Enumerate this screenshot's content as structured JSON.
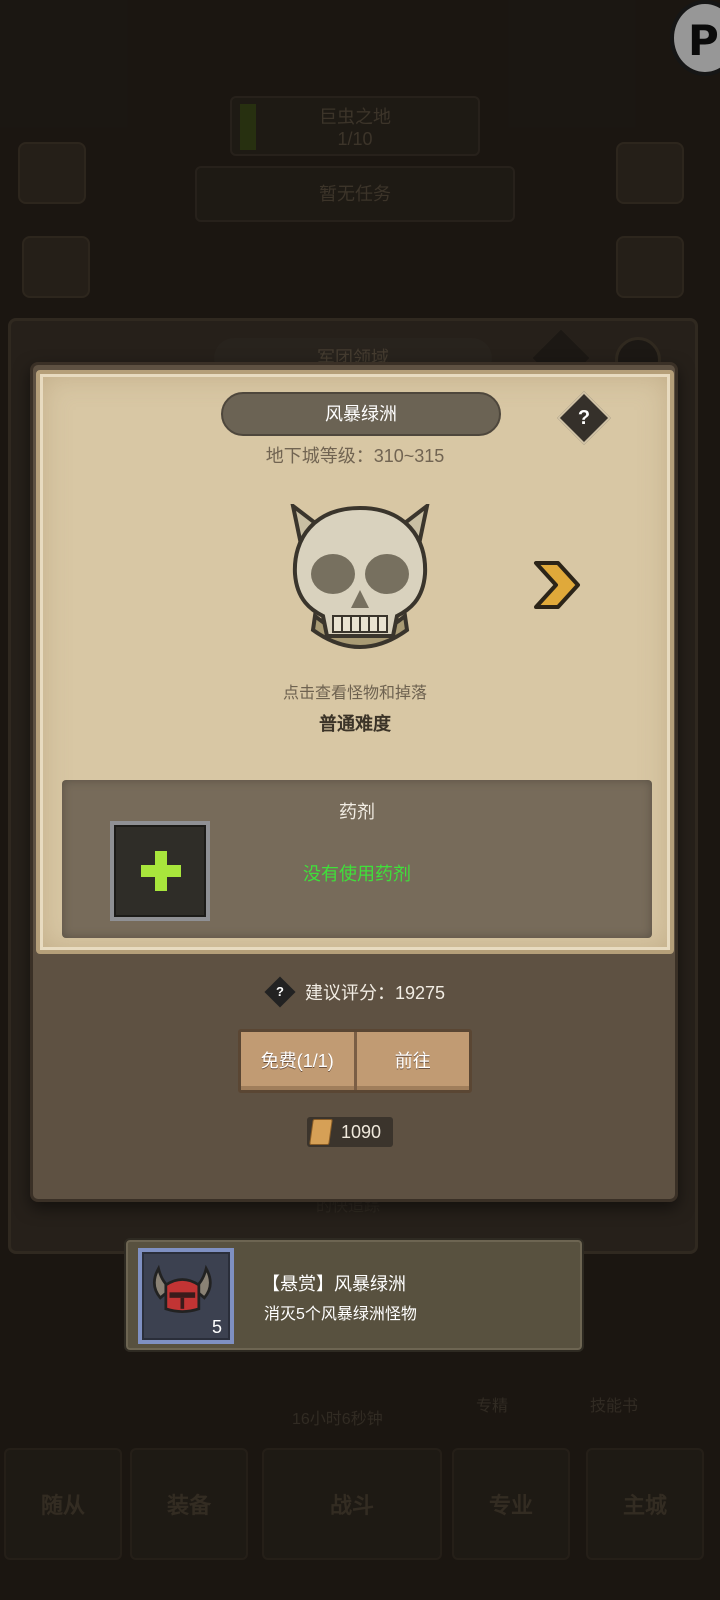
{
  "background": {
    "region_name": "巨虫之地",
    "region_progress": "1/10",
    "task_text": "暂无任务",
    "panel_title": "军团领域",
    "bottom_timer": "16小时6秒钟",
    "bottom_labels": [
      "专精",
      "技能书"
    ],
    "tabs": [
      "随从",
      "装备",
      "战斗",
      "专业",
      "主城"
    ],
    "behind_button": "的快追踪"
  },
  "dialog": {
    "title": "风暴绿洲",
    "help_label": "?",
    "dungeon_level": "地下城等级：310~315",
    "hint": "点击查看怪物和掉落",
    "difficulty": "普通难度",
    "potion": {
      "title": "药剂",
      "status": "没有使用药剂"
    },
    "score_help": "?",
    "score": "建议评分：19275",
    "buttons": {
      "free": "免费(1/1)",
      "go": "前往"
    },
    "cost": "1090"
  },
  "bounty": {
    "title": "【悬赏】风暴绿洲",
    "description": "消灭5个风暴绿洲怪物",
    "count": "5"
  },
  "colors": {
    "parchment": "#d8c7a4",
    "potion_status": "#3fe03a",
    "accent_arrow": "#e0a93a"
  }
}
